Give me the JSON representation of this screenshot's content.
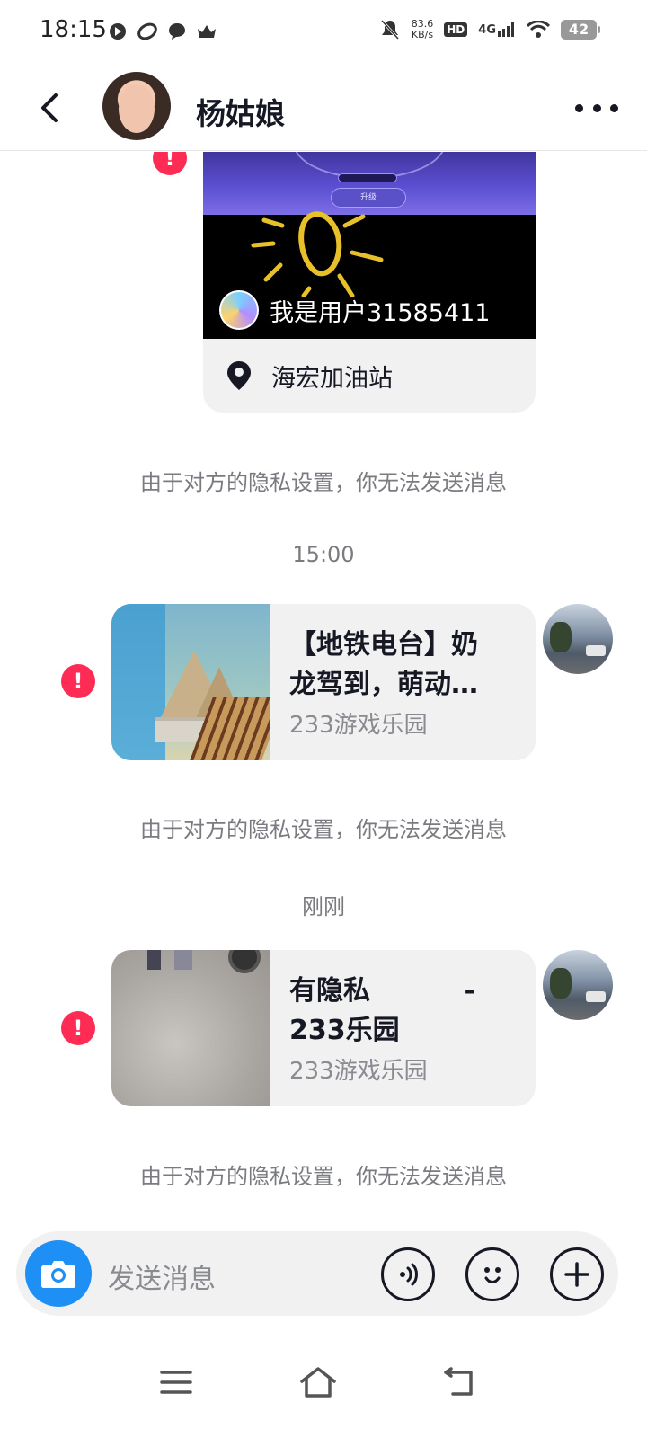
{
  "status_bar": {
    "time": "18:15",
    "net_speed_value": "83.6",
    "net_speed_unit": "KB/s",
    "hd": "HD",
    "network": "4G",
    "battery": "42"
  },
  "header": {
    "contact_name": "杨姑娘"
  },
  "messages": {
    "video_card": {
      "button_text": "升级",
      "user_name": "我是用户31585411",
      "location": "海宏加油站"
    },
    "privacy_note": "由于对方的隐私设置，你无法发送消息",
    "time_1": "15:00",
    "link_1": {
      "title": "【地铁电台】奶\n龙驾到，萌动…",
      "source": "233游戏乐园"
    },
    "time_2": "刚刚",
    "link_2": {
      "title": "有隐私          -\n233乐园",
      "source": "233游戏乐园"
    }
  },
  "input_bar": {
    "placeholder": "发送消息"
  },
  "colors": {
    "error": "#fe2c55",
    "camera": "#1e8ff5",
    "text_primary": "#161823",
    "text_secondary": "#7a7b80"
  }
}
